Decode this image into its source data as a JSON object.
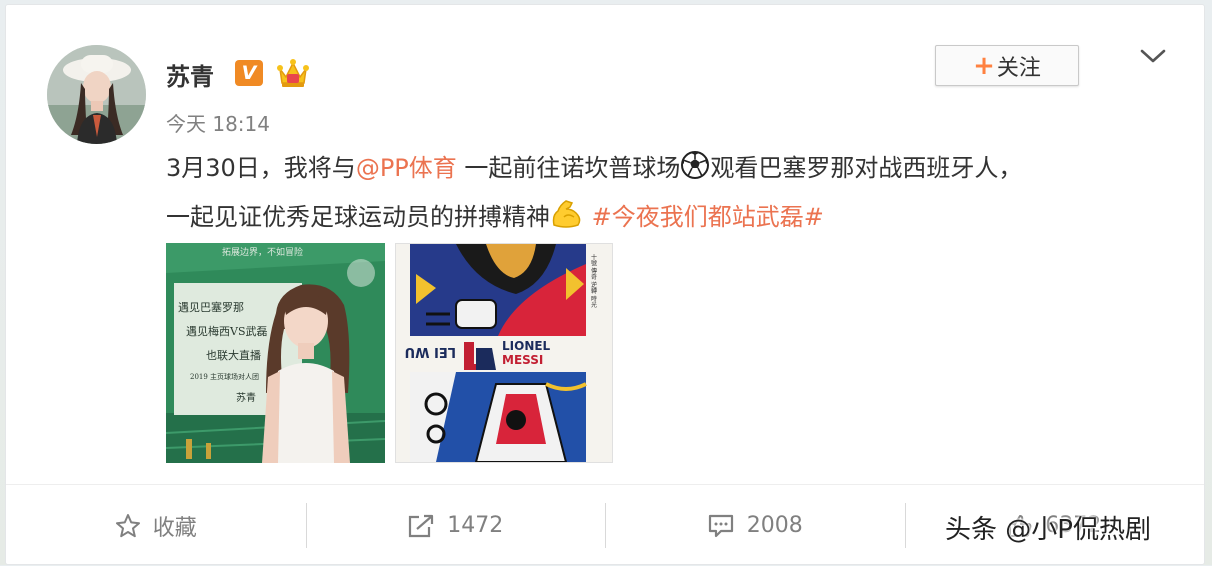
{
  "post": {
    "author": {
      "name": "苏青",
      "verified_badge": "V",
      "crown_icon": "crown-icon",
      "avatar_icon": "avatar-photo"
    },
    "timestamp": "今天 18:14",
    "follow_button": {
      "plus": "+",
      "label": "关注"
    },
    "menu_icon": "chevron-down-icon",
    "text": {
      "line1_a": "3月30日，我将与",
      "mention": "@PP体育",
      "line1_b": " 一起前往诺坎普球场",
      "line1_c": "观看巴塞罗那对战西班牙人，",
      "line2_a": "一起见证优秀足球运动员的拼搏精神",
      "hashtag": "#今夜我们都站武磊#"
    },
    "emojis": [
      "soccer-ball-icon",
      "flexed-biceps-icon"
    ],
    "photos": {
      "photo1": {
        "top_text": "拓展边界，不如冒险",
        "lines": [
          "遇见巴塞罗那",
          "遇见梅西VS武磊",
          "也联大直播",
          "2019 主页球场对人团",
          "苏青"
        ]
      },
      "photo2": {
        "side_text": "十號 傳奇 逆轉 時光",
        "lionel": "LIONEL",
        "messi": "MESSI",
        "mirror": "LEI WU"
      }
    }
  },
  "toolbar": {
    "favorite": {
      "label": "收藏",
      "icon": "star-icon"
    },
    "repost": {
      "count": "1472",
      "icon": "share-icon"
    },
    "comment": {
      "count": "2008",
      "icon": "comment-icon"
    },
    "like": {
      "count": "6372",
      "icon": "thumbs-up-icon"
    }
  },
  "watermark": "头条 @小P侃热剧",
  "colors": {
    "accent": "#eb7350",
    "plus": "#ff8140",
    "verified": "#f08a24",
    "muted": "#808080"
  }
}
